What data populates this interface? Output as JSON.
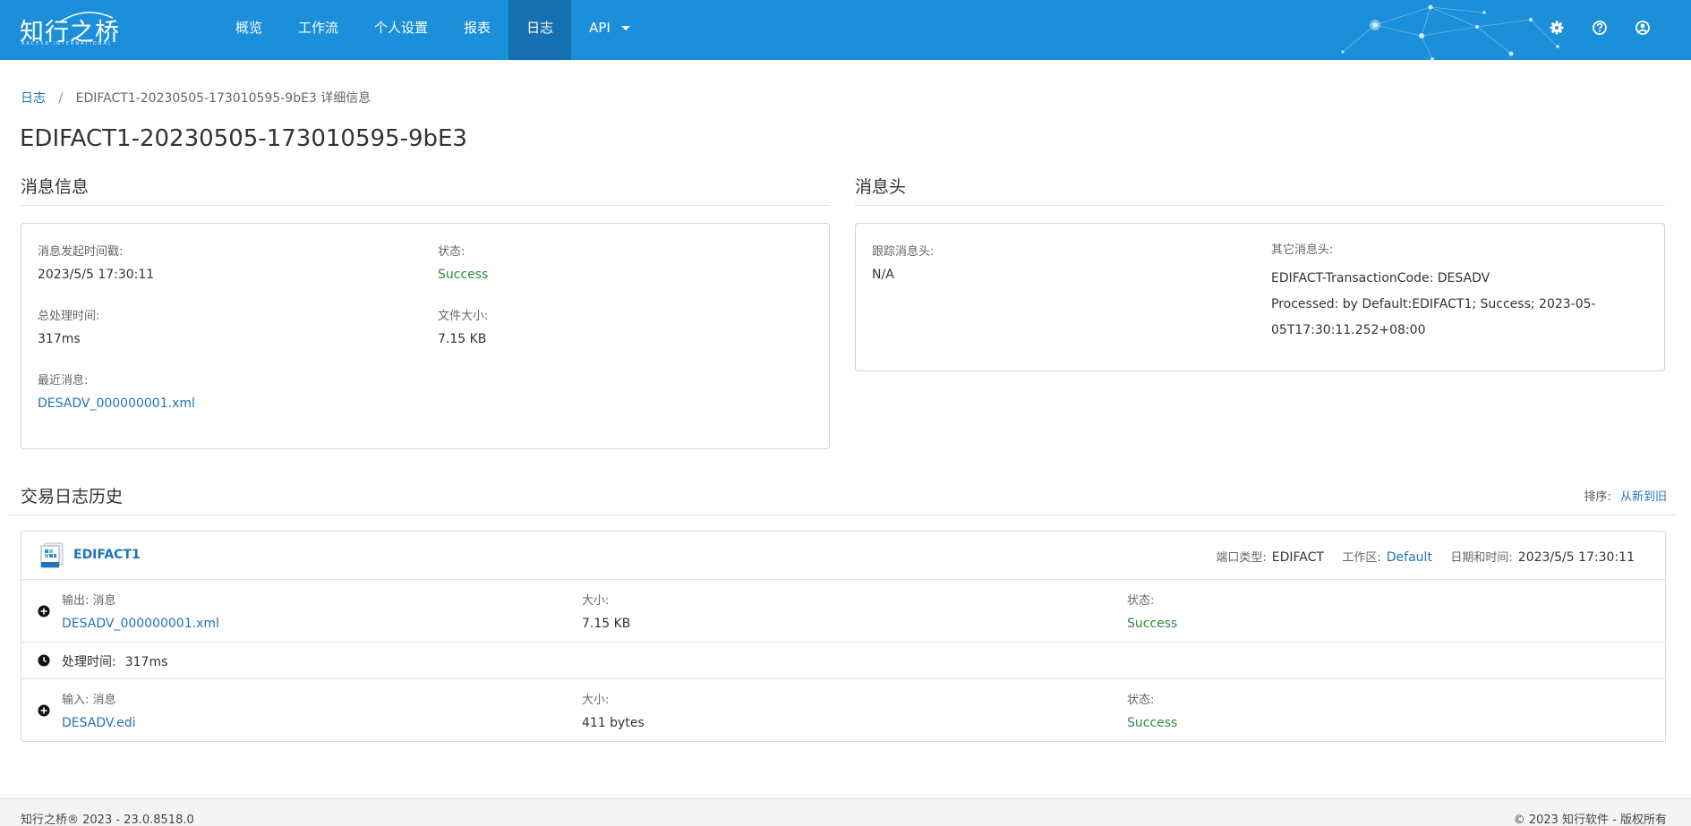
{
  "brand": {
    "name": "知行之桥",
    "subtitle": "ARCESB INTERNATIONAL"
  },
  "nav": {
    "items": [
      {
        "label": "概览"
      },
      {
        "label": "工作流"
      },
      {
        "label": "个人设置"
      },
      {
        "label": "报表"
      },
      {
        "label": "日志",
        "active": true
      },
      {
        "label": "API"
      }
    ],
    "icons": [
      "gear-icon",
      "help-icon",
      "user-icon"
    ]
  },
  "breadcrumb": {
    "root": "日志",
    "separator": "/",
    "current": "EDIFACT1-20230505-173010595-9bE3 详细信息"
  },
  "page_title": "EDIFACT1-20230505-173010595-9bE3",
  "message_info": {
    "title": "消息信息",
    "timestamp_label": "消息发起时间戳:",
    "timestamp_value": "2023/5/5 17:30:11",
    "status_label": "状态:",
    "status_value": "Success",
    "total_time_label": "总处理时间:",
    "total_time_value": "317ms",
    "file_size_label": "文件大小:",
    "file_size_value": "7.15 KB",
    "recent_label": "最近消息:",
    "recent_value": "DESADV_000000001.xml"
  },
  "message_header": {
    "title": "消息头",
    "trace_label": "跟踪消息头:",
    "trace_value": "N/A",
    "other_label": "其它消息头:",
    "other_line1": "EDIFACT-TransactionCode: DESADV",
    "other_line2": "Processed: by Default:EDIFACT1; Success; 2023-05-",
    "other_line3": "05T17:30:11.252+08:00"
  },
  "history": {
    "title": "交易日志历史",
    "sort_label": "排序:",
    "sort_value": "从新到旧",
    "port": {
      "name": "EDIFACT1",
      "type_label": "端口类型:",
      "type_value": "EDIFACT",
      "workspace_label": "工作区:",
      "workspace_value": "Default",
      "datetime_label": "日期和时间:",
      "datetime_value": "2023/5/5 17:30:11"
    },
    "output": {
      "label": "输出: 消息",
      "file": "DESADV_000000001.xml",
      "size_label": "大小:",
      "size_value": "7.15 KB",
      "status_label": "状态:",
      "status_value": "Success"
    },
    "processing": {
      "label": "处理时间:",
      "value": "317ms"
    },
    "input": {
      "label": "输入: 消息",
      "file": "DESADV.edi",
      "size_label": "大小:",
      "size_value": "411 bytes",
      "status_label": "状态:",
      "status_value": "Success"
    }
  },
  "footer": {
    "left": "知行之桥® 2023 - 23.0.8518.0",
    "right": "© 2023 知行软件 - 版权所有"
  },
  "colors": {
    "navbar": "#1b8fd9",
    "nav_active": "#1670b0",
    "link": "#1f74b8",
    "success": "#2e8b3e"
  }
}
